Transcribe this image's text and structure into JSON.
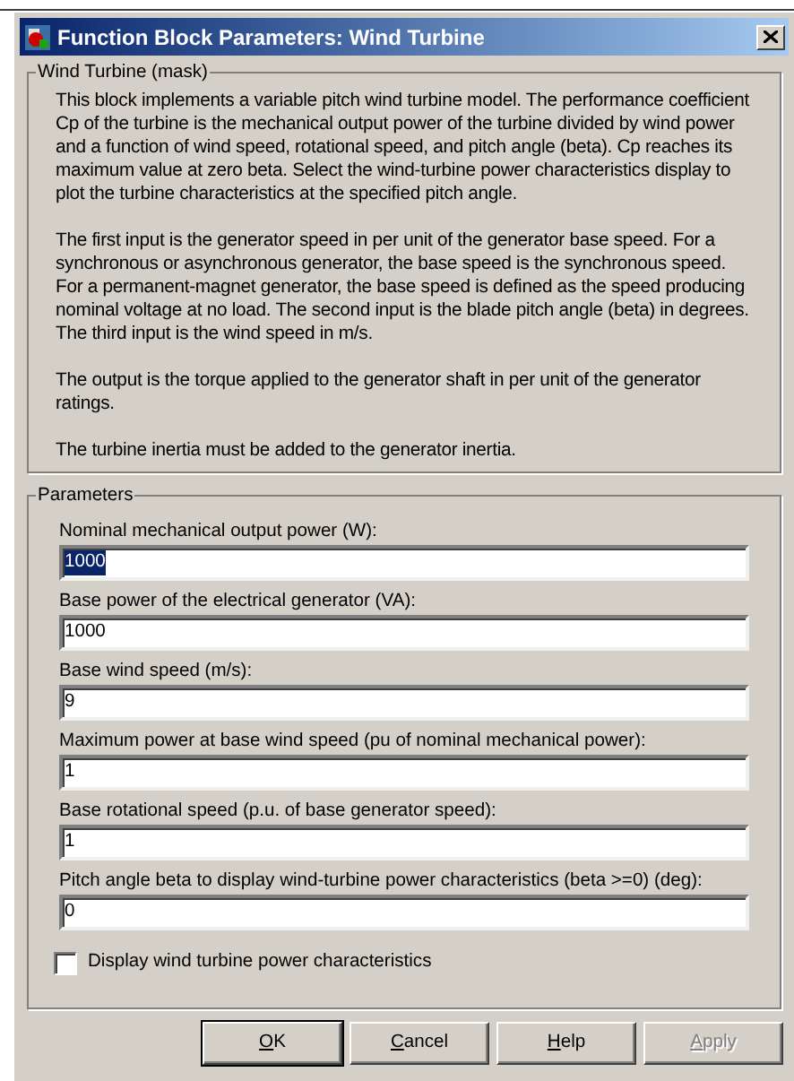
{
  "window": {
    "title": "Function Block Parameters: Wind Turbine"
  },
  "description": {
    "title": "Wind Turbine (mask)",
    "paragraphs": [
      "This block implements a variable pitch wind turbine model. The performance coefficient Cp of the turbine is the mechanical output power of the turbine divided by wind power and a function of wind speed, rotational speed, and pitch angle (beta). Cp reaches its maximum value at zero beta. Select the wind-turbine power characteristics display to plot the turbine characteristics at the specified pitch angle.",
      "The first input is the generator speed in per unit of the generator base speed. For a synchronous or asynchronous generator, the base speed is the synchronous speed. For a permanent-magnet generator, the base speed is defined as the speed producing nominal voltage at  no load. The second input is the blade pitch angle (beta) in degrees. The third input is the wind speed in m/s.",
      "The output is the torque applied to the generator shaft in per unit of the generator ratings.",
      "The turbine inertia must be added to the generator inertia."
    ]
  },
  "parameters": {
    "title": "Parameters",
    "fields": [
      {
        "label": "Nominal mechanical output power (W):",
        "value": "1000",
        "selected": true
      },
      {
        "label": "Base power of the electrical generator (VA):",
        "value": "1000",
        "selected": false
      },
      {
        "label": "Base wind speed (m/s):",
        "value": "9",
        "selected": false
      },
      {
        "label": "Maximum power at base wind speed (pu of nominal mechanical power):",
        "value": "1",
        "selected": false
      },
      {
        "label": "Base rotational speed (p.u. of base generator speed):",
        "value": "1",
        "selected": false
      },
      {
        "label": "Pitch angle beta to display wind-turbine power characteristics (beta >=0)  (deg):",
        "value": "0",
        "selected": false
      }
    ],
    "checkbox": {
      "label": "Display wind turbine power characteristics",
      "checked": false
    }
  },
  "buttons": [
    {
      "mnemonic": "O",
      "rest": "K",
      "disabled": false
    },
    {
      "mnemonic": "C",
      "rest": "ancel",
      "disabled": false
    },
    {
      "mnemonic": "H",
      "rest": "elp",
      "disabled": false
    },
    {
      "mnemonic": "A",
      "rest": "pply",
      "disabled": true
    }
  ]
}
